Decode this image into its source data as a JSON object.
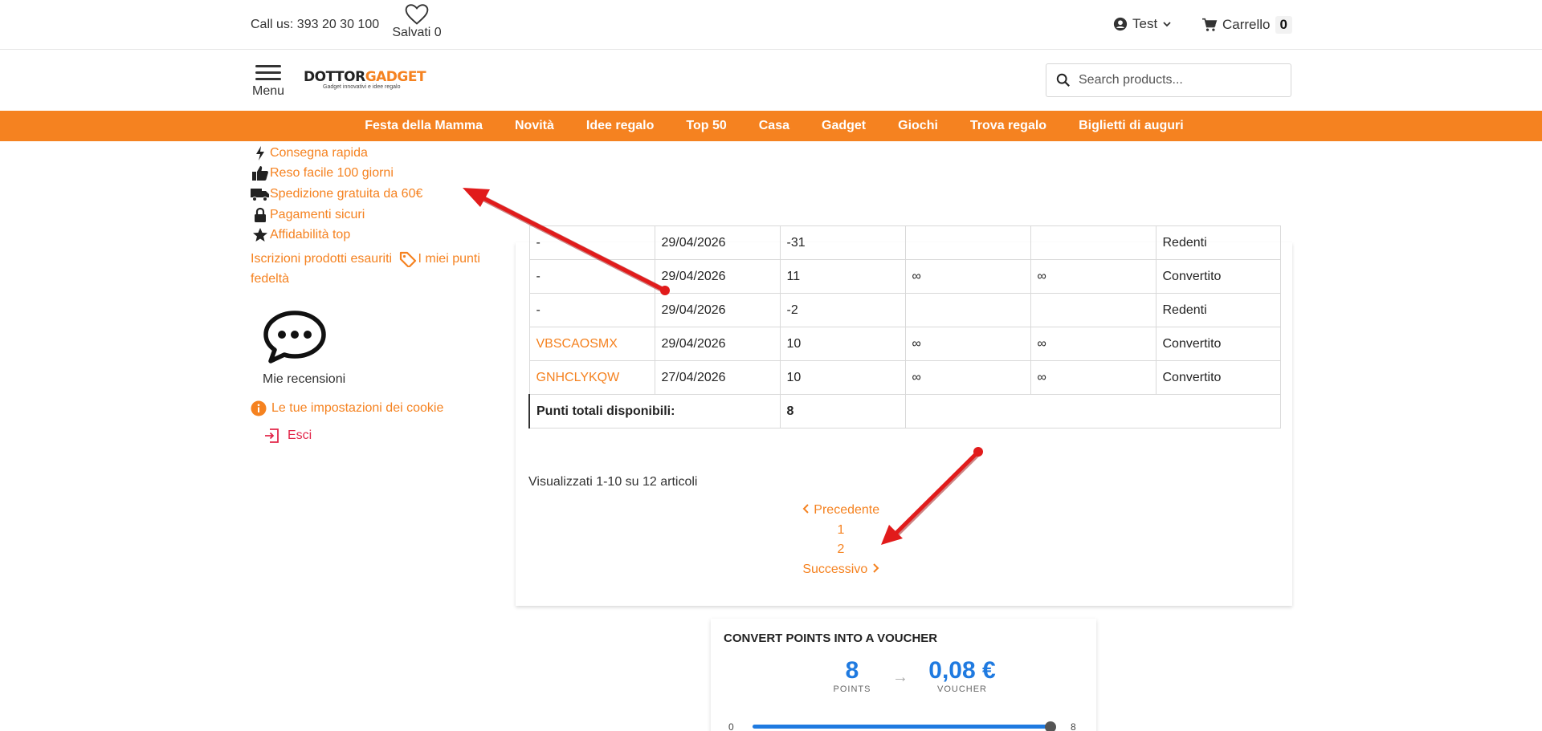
{
  "topbar": {
    "call_us": "Call us: 393 20 30 100",
    "saved_label": "Salvati 0",
    "user_name": "Test",
    "cart_label": "Carrello",
    "cart_count": "0"
  },
  "header": {
    "menu_label": "Menu",
    "logo_part1": "DOTTOR",
    "logo_part2": "GADGET",
    "logo_tagline": "Gadget innovativi e idee regalo",
    "search_placeholder": "Search products..."
  },
  "nav": {
    "items": [
      "Festa della Mamma",
      "Novità",
      "Idee regalo",
      "Top 50",
      "Casa",
      "Gadget",
      "Giochi",
      "Trova regalo",
      "Biglietti di auguri"
    ]
  },
  "sidebar": {
    "features": [
      {
        "icon": "bolt-icon",
        "label": "Consegna rapida"
      },
      {
        "icon": "thumbs-up-icon",
        "label": "Reso facile 100 giorni"
      },
      {
        "icon": "truck-icon",
        "label": "Spedizione gratuita da 60€"
      },
      {
        "icon": "lock-icon",
        "label": "Pagamenti sicuri"
      },
      {
        "icon": "star-icon",
        "label": "Affidabilità top"
      }
    ],
    "subscriptions_label": "Iscrizioni prodotti esauriti",
    "loyalty_label": "I miei punti fedeltà",
    "reviews_label": "Mie recensioni",
    "cookie_label": "Le tue impostazioni dei cookie",
    "logout_label": "Esci"
  },
  "points_table": {
    "rows": [
      {
        "code": "-",
        "date": "29/04/2026",
        "points": "-31",
        "c4": "",
        "c5": "",
        "status": "Redenti",
        "link": false
      },
      {
        "code": "-",
        "date": "29/04/2026",
        "points": "11",
        "c4": "∞",
        "c5": "∞",
        "status": "Convertito",
        "link": false
      },
      {
        "code": "-",
        "date": "29/04/2026",
        "points": "-2",
        "c4": "",
        "c5": "",
        "status": "Redenti",
        "link": false
      },
      {
        "code": "VBSCAOSMX",
        "date": "29/04/2026",
        "points": "10",
        "c4": "∞",
        "c5": "∞",
        "status": "Convertito",
        "link": true
      },
      {
        "code": "GNHCLYKQW",
        "date": "27/04/2026",
        "points": "10",
        "c4": "∞",
        "c5": "∞",
        "status": "Convertito",
        "link": true
      }
    ],
    "total_label": "Punti totali disponibili:",
    "total_value": "8",
    "summary": "Visualizzati 1-10 su 12 articoli"
  },
  "pagination": {
    "prev": "Precedente",
    "pages": [
      "1",
      "2"
    ],
    "next": "Successivo"
  },
  "voucher": {
    "title": "CONVERT POINTS INTO A VOUCHER",
    "points_value": "8",
    "points_label": "POINTS",
    "voucher_value": "0,08 €",
    "voucher_label": "VOUCHER",
    "slider_min": "0",
    "slider_max": "8",
    "slider_fraction": 1.0,
    "accent_color": "#1f7ae0"
  },
  "colors": {
    "brand_orange": "#f58220",
    "annotation_red": "#e11b1b"
  }
}
